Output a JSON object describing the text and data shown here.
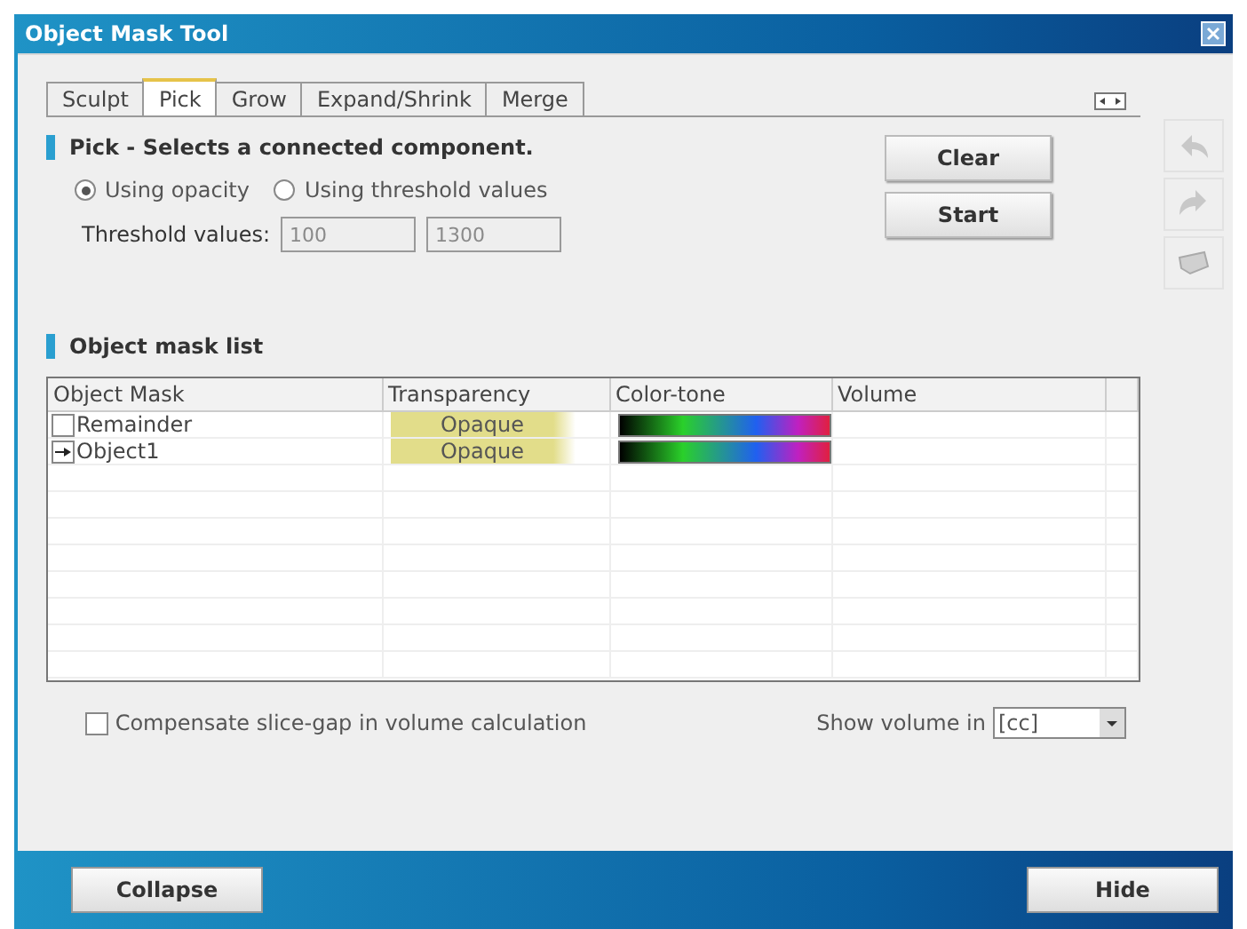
{
  "window": {
    "title": "Object Mask Tool"
  },
  "tabs": [
    {
      "label": "Sculpt",
      "selected": false
    },
    {
      "label": "Pick",
      "selected": true
    },
    {
      "label": "Grow",
      "selected": false
    },
    {
      "label": "Expand/Shrink",
      "selected": false
    },
    {
      "label": "Merge",
      "selected": false
    }
  ],
  "pick_section": {
    "heading": "Pick - Selects a connected component.",
    "options": [
      {
        "label": "Using opacity",
        "selected": true
      },
      {
        "label": "Using threshold values",
        "selected": false
      }
    ],
    "threshold_label": "Threshold values:",
    "thresholds": [
      {
        "value": "100",
        "disabled": true
      },
      {
        "value": "1300",
        "disabled": true
      }
    ],
    "buttons": [
      "Clear",
      "Start"
    ]
  },
  "list_section": {
    "heading": "Object mask list",
    "columns": [
      "Object Mask",
      "Transparency",
      "Color-tone",
      "Volume"
    ],
    "rows": [
      {
        "name": "Remainder",
        "current": false,
        "transparency": "Opaque"
      },
      {
        "name": "Object1",
        "current": true,
        "transparency": "Opaque"
      }
    ]
  },
  "compensate": {
    "label": "Compensate slice-gap in volume calculation",
    "checked": false
  },
  "volume_unit": {
    "label": "Show volume in",
    "value": "[cc]"
  },
  "footer_buttons": [
    "Collapse",
    "Hide"
  ]
}
